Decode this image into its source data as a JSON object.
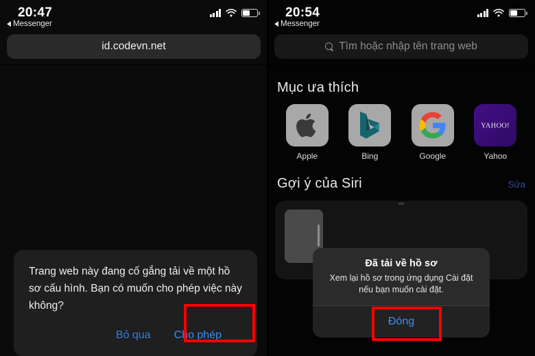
{
  "left_phone": {
    "status": {
      "time": "20:47",
      "back_label": "Messenger",
      "signal_icon": "cellular-signal-icon",
      "wifi_icon": "wifi-icon",
      "battery_icon": "battery-icon",
      "battery_level_percent": 44
    },
    "urlbar": {
      "value": "id.codevn.net",
      "name": "address-bar"
    },
    "alert": {
      "message": "Trang web này đang cố gắng tải về một hồ sơ cấu hình. Bạn có muốn cho phép việc này không?",
      "ignore_label": "Bỏ qua",
      "allow_label": "Cho phép"
    }
  },
  "right_phone": {
    "status": {
      "time": "20:54",
      "back_label": "Messenger",
      "signal_icon": "cellular-signal-icon",
      "wifi_icon": "wifi-icon",
      "battery_icon": "battery-icon",
      "battery_level_percent": 44
    },
    "searchbar": {
      "placeholder": "Tìm hoặc nhập tên trang web",
      "icon": "search-icon"
    },
    "favorites": {
      "title": "Mục ưa thích",
      "items": [
        {
          "label": "Apple",
          "icon": "apple-logo-icon",
          "tile_color": "#a8a8a8"
        },
        {
          "label": "Bing",
          "icon": "bing-logo-icon",
          "tile_color": "#a8a8a8"
        },
        {
          "label": "Google",
          "icon": "google-logo-icon",
          "tile_color": "#a8a8a8"
        },
        {
          "label": "Yahoo",
          "icon": "yahoo-logo-icon",
          "tile_color": "#3d0f7a"
        }
      ]
    },
    "siri": {
      "title": "Gợi ý của Siri",
      "edit_label": "Sửa"
    },
    "alert": {
      "title": "Đã tải về hồ sơ",
      "subtitle": "Xem lại hồ sơ trong ứng dụng Cài đặt nếu bạn muốn cài đặt.",
      "close_label": "Đóng"
    }
  },
  "annotations": {
    "highlight_color": "#ff0000",
    "boxes": [
      {
        "name": "allow-button-highlight",
        "target": "Cho phép"
      },
      {
        "name": "close-button-highlight",
        "target": "Đóng"
      }
    ]
  }
}
